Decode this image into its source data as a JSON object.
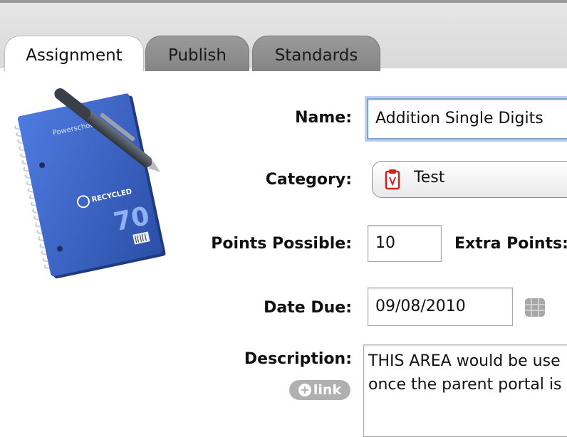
{
  "tabs": [
    "Assignment",
    "Publish",
    "Standards"
  ],
  "notebook": {
    "brand": "Powerschool",
    "badge": "RECYCLED",
    "number": "70"
  },
  "form": {
    "name_label": "Name:",
    "name_value": "Addition Single Digits",
    "category_label": "Category:",
    "category_value": "Test",
    "points_label": "Points Possible:",
    "points_value": "10",
    "extra_label": "Extra Points:",
    "date_label": "Date Due:",
    "date_value": "09/08/2010",
    "description_label": "Description:",
    "link_label": "link",
    "description_text": "THIS AREA would be use\nonce the parent portal is"
  },
  "icons": {
    "category": "clipboard-icon",
    "calendar": "calendar-icon",
    "add": "plus-icon",
    "illustration": "notebook-with-pen-icon"
  },
  "colors": {
    "focus_ring": "#7ea5d8",
    "notebook_blue": "#3f66c4",
    "link_button": "#b0b0b0"
  }
}
